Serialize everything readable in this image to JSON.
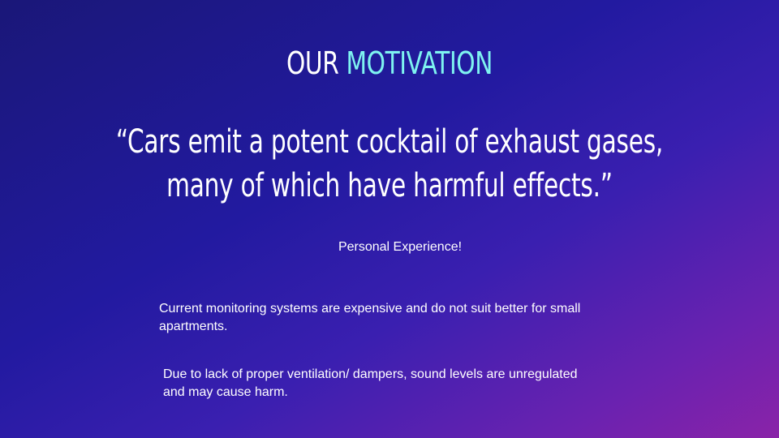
{
  "title": {
    "prefix": "OUR",
    "highlight": "MOTIVATION"
  },
  "quote": {
    "line1": "“Cars emit a potent cocktail of exhaust gases,",
    "line2": "many of which have harmful effects.”"
  },
  "notes": {
    "personal": "Personal Experience!",
    "current": "Current monitoring systems are expensive and do not suit better for small apartments.",
    "sound": "Due to lack of proper ventilation/ dampers, sound levels are unregulated and may cause harm."
  },
  "colors": {
    "accent": "#7ef3f0",
    "background_start": "#1a1778",
    "background_end": "#8a23a8"
  }
}
